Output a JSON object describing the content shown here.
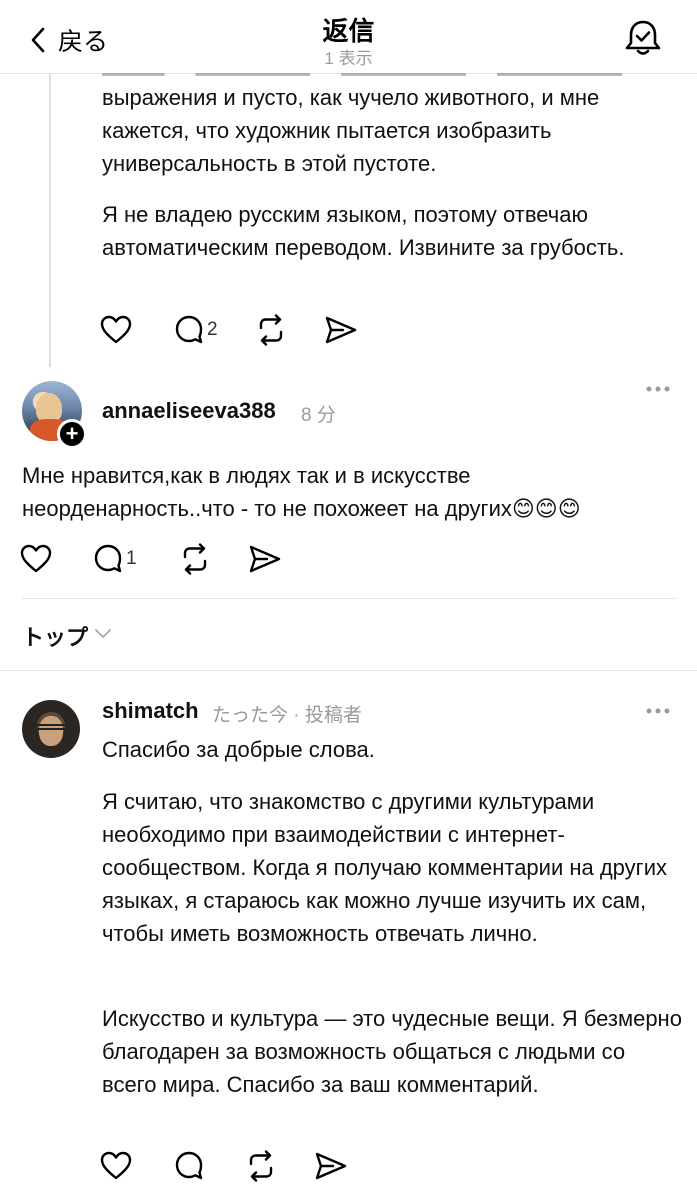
{
  "header": {
    "back_label": "戻る",
    "title": "返信",
    "subtitle": "1 表示"
  },
  "reply": {
    "paragraphs": [
      "выражения и пусто, как чучело животного, и мне кажется, что художник пытается изобразить универсальность в этой пустоте.",
      "Я не владею русским языком, поэтому отвечаю автоматическим переводом. Извините за грубость."
    ],
    "reply_count": "2"
  },
  "comment_anna": {
    "username": "annaeliseeva388",
    "time": "8 分",
    "text": "Мне нравится,как в людях так и в искусстве неорденарность..что - то не похожеет на других😊😊😊",
    "reply_count": "1"
  },
  "sort": {
    "label": "トップ"
  },
  "comment_shima": {
    "username": "shimatch",
    "meta": "たった今 · 投稿者",
    "paragraphs": [
      "Спасибо за добрые слова.",
      "Я считаю, что знакомство с другими культурами необходимо при взаимодействии с интернет-сообществом. Когда я получаю комментарии на других языках, я стараюсь как можно лучше изучить их сам, чтобы иметь возможность отвечать лично.",
      "Искусство и культура — это чудесные вещи. Я безмерно благодарен за возможность общаться с людьми со всего мира. Спасибо за ваш комментарий."
    ]
  },
  "icons": {
    "back": "chevron-left-icon",
    "notifications": "bell-check-icon",
    "like": "heart-icon",
    "reply": "comment-bubble-icon",
    "repost": "repost-icon",
    "share": "send-icon",
    "more": "more-dots-icon",
    "sort_toggle": "chevron-down-icon",
    "follow": "plus-icon"
  }
}
